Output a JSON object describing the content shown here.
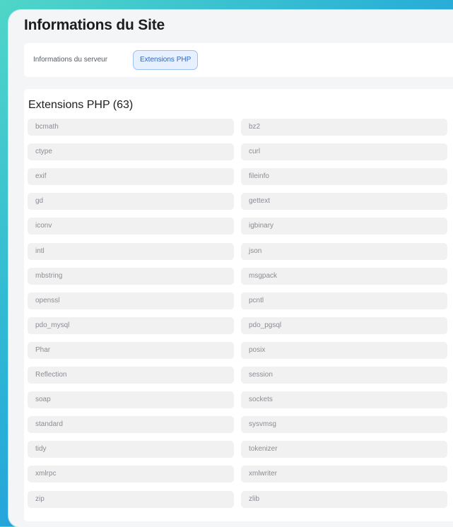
{
  "window": {
    "title": "Informations du Site"
  },
  "tabs": [
    {
      "label": "Informations du serveur",
      "active": false
    },
    {
      "label": "Extensions PHP",
      "active": true
    }
  ],
  "section": {
    "title": "Extensions PHP (63)"
  },
  "extensions": [
    "bcmath",
    "bz2",
    "ctype",
    "curl",
    "exif",
    "fileinfo",
    "gd",
    "gettext",
    "iconv",
    "igbinary",
    "intl",
    "json",
    "mbstring",
    "msgpack",
    "openssl",
    "pcntl",
    "pdo_mysql",
    "pdo_pgsql",
    "Phar",
    "posix",
    "Reflection",
    "session",
    "soap",
    "sockets",
    "standard",
    "sysvmsg",
    "tidy",
    "tokenizer",
    "xmlrpc",
    "xmlwriter",
    "zip",
    "zlib"
  ],
  "colors": {
    "accent": "#2a64c9",
    "accent_bg": "#e6f0ff",
    "cell_bg": "#f1f1f2"
  }
}
